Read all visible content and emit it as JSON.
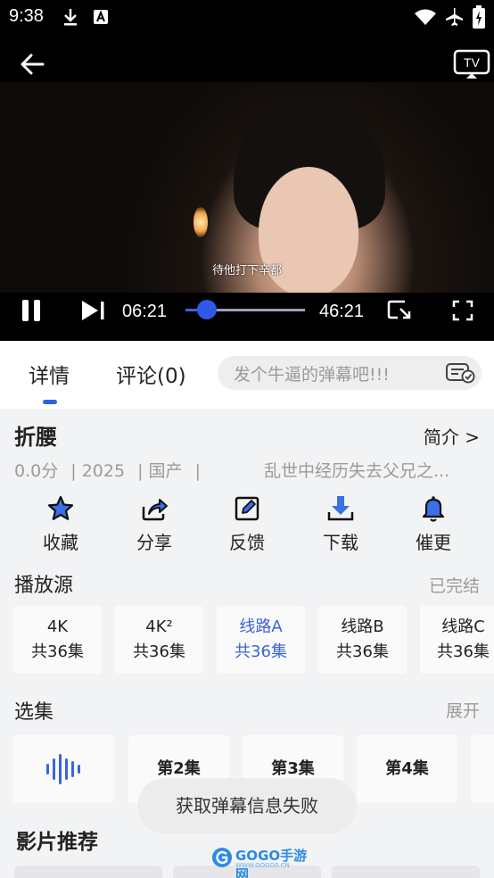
{
  "status_bar": {
    "time": "9:38"
  },
  "player": {
    "subtitle": "待他打下辛都",
    "current_time": "06:21",
    "total_time": "46:21",
    "progress": 0.18
  },
  "tabs": [
    {
      "label": "详情"
    },
    {
      "label": "评论(0)"
    }
  ],
  "danmaku": {
    "placeholder": "发个牛逼的弹幕吧!!!"
  },
  "show": {
    "title": "折腰",
    "intro_link": "简介 >",
    "score": "0.0分",
    "year": "| 2025",
    "region": "|  国产",
    "separator": "|",
    "description": "乱世中经历失去父兄之..."
  },
  "actions": [
    {
      "label": "收藏",
      "icon": "star-icon"
    },
    {
      "label": "分享",
      "icon": "share-icon"
    },
    {
      "label": "反馈",
      "icon": "edit-icon"
    },
    {
      "label": "下载",
      "icon": "download-icon"
    },
    {
      "label": "催更",
      "icon": "bell-icon"
    }
  ],
  "sources": {
    "title": "播放源",
    "status": "已完结",
    "items": [
      {
        "name": "4K",
        "episodes": "共36集"
      },
      {
        "name": "4K²",
        "episodes": "共36集"
      },
      {
        "name": "线路A",
        "episodes": "共36集"
      },
      {
        "name": "线路B",
        "episodes": "共36集"
      },
      {
        "name": "线路C",
        "episodes": "共36集"
      }
    ]
  },
  "episodes": {
    "title": "选集",
    "expand": "展开",
    "items": [
      {
        "label": ""
      },
      {
        "label": "第2集"
      },
      {
        "label": "第3集"
      },
      {
        "label": "第4集"
      }
    ]
  },
  "toast": "获取弹幕信息失败",
  "recommend": {
    "title": "影片推荐"
  },
  "watermark": {
    "text": "GOGO手游网",
    "sub": "WWW.GOGO0.CN"
  },
  "colors": {
    "accent": "#3060e8",
    "active_source": "#3b64d6",
    "muted": "#9b9b9b"
  }
}
